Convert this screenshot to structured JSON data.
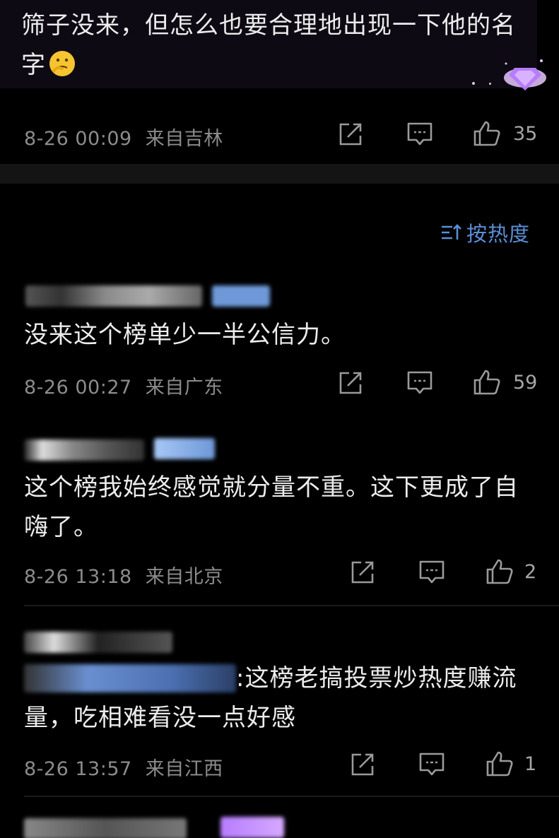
{
  "top_comment": {
    "text": "筛子没来，但怎么也要合理地出现一下他的名字",
    "emoji": "thinking-emoji",
    "time": "8-26 00:09",
    "location": "来自吉林",
    "likes": "35"
  },
  "sort": {
    "label": "按热度",
    "icon": "sort-icon"
  },
  "comments": [
    {
      "text": "没来这个榜单少一半公信力。",
      "time": "8-26 00:27",
      "location": "来自广东",
      "likes": "59"
    },
    {
      "text": "这个榜我始终感觉就分量不重。这下更成了自嗨了。",
      "time": "8-26 13:18",
      "location": "来自北京",
      "likes": "2"
    },
    {
      "text": ":这榜老搞投票炒热度赚流量，吃相难看没一点好感",
      "time": "8-26 13:57",
      "location": "来自江西",
      "likes": "1"
    }
  ],
  "colors": {
    "accent": "#5b8fd6",
    "background": "#000000",
    "badge": "#b77cff"
  }
}
